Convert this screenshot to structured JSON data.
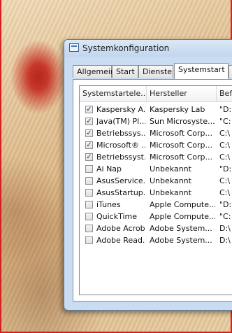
{
  "window": {
    "title": "Systemkonfiguration"
  },
  "tabs": [
    {
      "label": "Allgemein"
    },
    {
      "label": "Start"
    },
    {
      "label": "Dienste"
    },
    {
      "label": "Systemstart",
      "active": true
    }
  ],
  "columns": [
    {
      "label": "Systemstartele..."
    },
    {
      "label": "Hersteller"
    },
    {
      "label": "Bef"
    }
  ],
  "rows": [
    {
      "checked": true,
      "name": "Kaspersky A...",
      "manufacturer": "Kaspersky Lab",
      "command": "\"D:"
    },
    {
      "checked": true,
      "name": "Java(TM) Pl...",
      "manufacturer": "Sun Microsyste...",
      "command": "\"C:"
    },
    {
      "checked": true,
      "name": "Betriebssys...",
      "manufacturer": "Microsoft Corp...",
      "command": "C:\\"
    },
    {
      "checked": true,
      "name": "Microsoft® ...",
      "manufacturer": "Microsoft Corp...",
      "command": "C:\\"
    },
    {
      "checked": true,
      "name": "Betriebssyst...",
      "manufacturer": "Microsoft Corp...",
      "command": "C:\\"
    },
    {
      "checked": false,
      "name": "Ai Nap",
      "manufacturer": "Unbekannt",
      "command": "\"D:"
    },
    {
      "checked": false,
      "name": "AsusService...",
      "manufacturer": "Unbekannt",
      "command": "C:\\"
    },
    {
      "checked": false,
      "name": "AsusStartup...",
      "manufacturer": "Unbekannt",
      "command": "C:\\"
    },
    {
      "checked": false,
      "name": "iTunes",
      "manufacturer": "Apple Compute...",
      "command": "\"D:"
    },
    {
      "checked": false,
      "name": "QuickTime",
      "manufacturer": "Apple Compute...",
      "command": "\"C:"
    },
    {
      "checked": false,
      "name": "Adobe Acrobat",
      "manufacturer": "Adobe System...",
      "command": "D:\\"
    },
    {
      "checked": false,
      "name": "Adobe Read...",
      "manufacturer": "Adobe System...",
      "command": "D:\\"
    }
  ],
  "colors": {
    "wallpaper_border": "#d61f1f",
    "window_frame": "#c9dcf1"
  }
}
